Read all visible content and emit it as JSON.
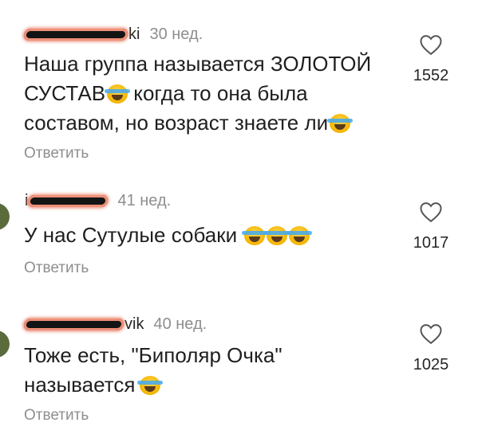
{
  "comments": [
    {
      "username_tail": "ki",
      "time": "30 нед.",
      "text_line1": "Наша группа называется ЗОЛОТОЙ",
      "text_line2a": "СУСТАВ",
      "text_line2b": " когда то она была",
      "text_line3": "составом, но возраст знаете ли",
      "likes": "1552",
      "reply_label": "Ответить"
    },
    {
      "username_tail": "i",
      "time": "41 нед.",
      "text": "У нас Сутулые собаки ",
      "likes": "1017",
      "reply_label": "Ответить"
    },
    {
      "username_tail": "vik",
      "time": "40 нед.",
      "text_line1": "Тоже есть, \"Биполяр Очка\"",
      "text_line2": "называется",
      "likes": "1025",
      "reply_label": "Ответить"
    }
  ],
  "icons": {
    "like": "heart-outline-icon",
    "emoji": "laughing-tears-emoji"
  }
}
